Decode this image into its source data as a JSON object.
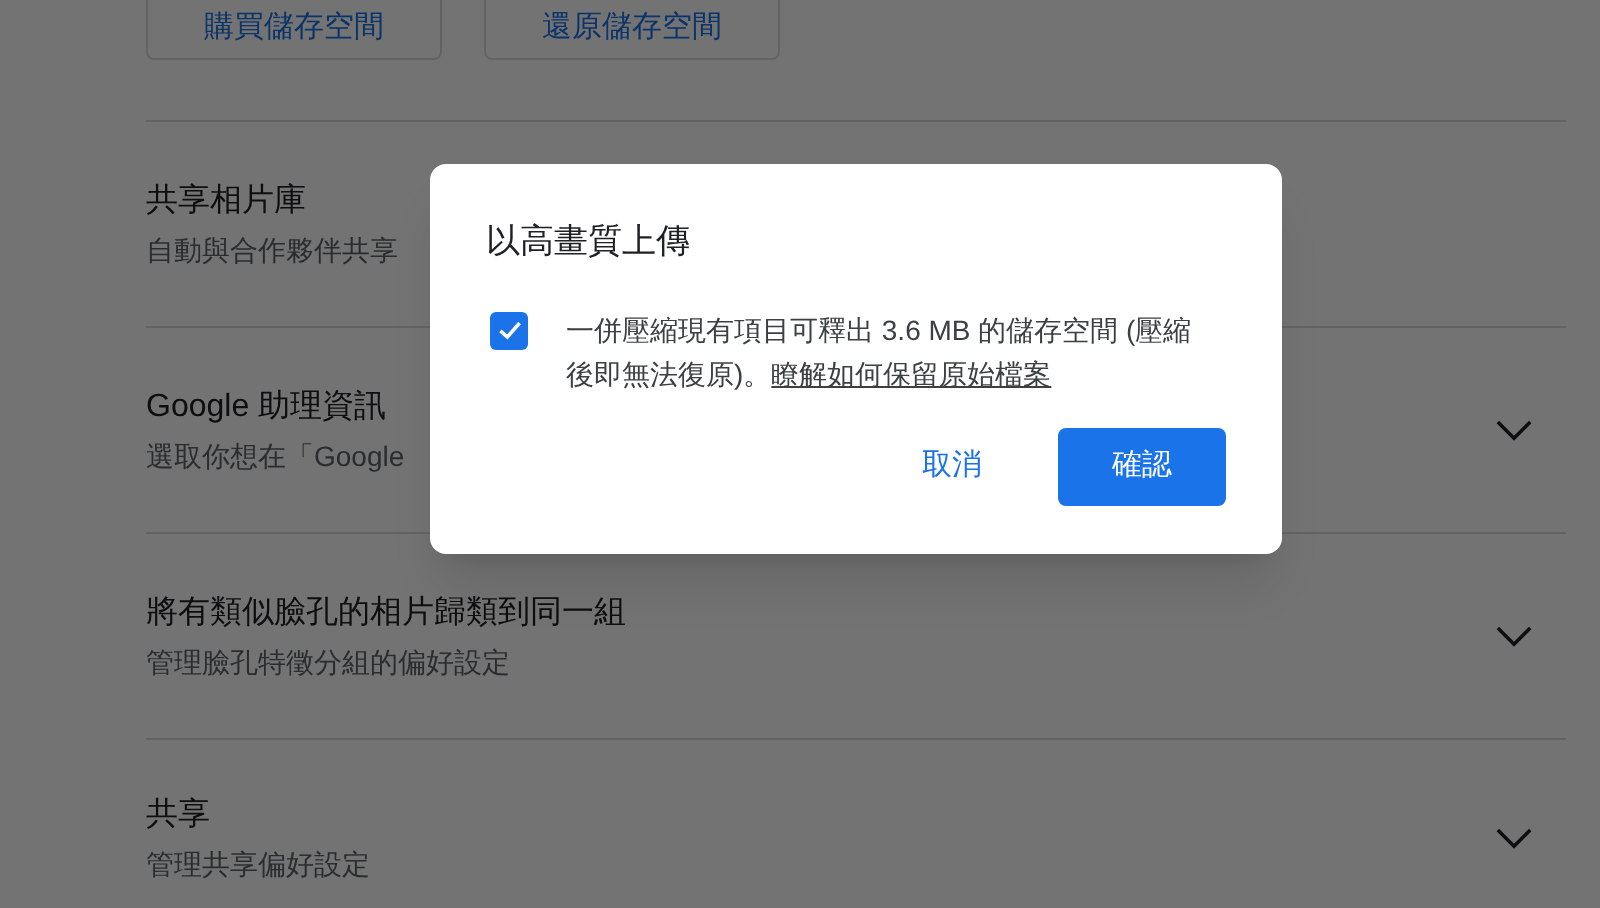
{
  "storage_buttons": [
    "購買儲存空間",
    "還原儲存空間"
  ],
  "settings": [
    {
      "title": "共享相片庫",
      "subtitle": "自動與合作夥伴共享",
      "expandable": false
    },
    {
      "title": "Google 助理資訊",
      "subtitle": "選取你想在「Google",
      "expandable": true
    },
    {
      "title": "將有類似臉孔的相片歸類到同一組",
      "subtitle": "管理臉孔特徵分組的偏好設定",
      "expandable": true
    },
    {
      "title": "共享",
      "subtitle": "管理共享偏好設定",
      "expandable": true
    }
  ],
  "dialog": {
    "title": "以高畫質上傳",
    "option": {
      "checked": true,
      "text": "一併壓縮現有項目可釋出 3.6 MB 的儲存空間 (壓縮後即無法復原)。",
      "link": "瞭解如何保留原始檔案"
    },
    "buttons": [
      {
        "label": "取消",
        "kind": "text"
      },
      {
        "label": "確認",
        "kind": "filled"
      }
    ]
  }
}
